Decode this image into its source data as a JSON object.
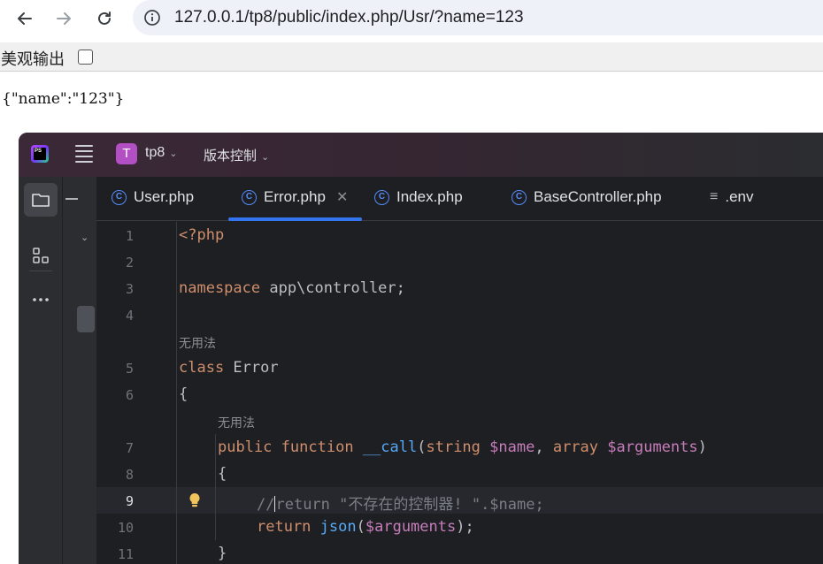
{
  "browser": {
    "url": "127.0.0.1/tp8/public/index.php/Usr/?name=123",
    "icons": [
      "back-icon",
      "forward-icon",
      "reload-icon",
      "info-icon"
    ]
  },
  "page": {
    "pretty_print_label": "美观输出",
    "pretty_print_checked": false,
    "json_output": "{\"name\":\"123\"}"
  },
  "ide": {
    "project_badge": "T",
    "project_name": "tp8",
    "vcs_label": "版本控制",
    "tabs": [
      {
        "label": "User.php",
        "icon": "class-icon",
        "active": false
      },
      {
        "label": "Error.php",
        "icon": "class-icon",
        "active": true
      },
      {
        "label": "Index.php",
        "icon": "class-icon",
        "active": false
      },
      {
        "label": "BaseController.php",
        "icon": "class-icon",
        "active": false
      },
      {
        "label": ".env",
        "icon": "text-file-icon",
        "active": false
      }
    ],
    "accent_color": "#3574f0",
    "hints": {
      "h1": "无用法",
      "h2": "无用法"
    },
    "lines": {
      "n1": "1",
      "n2": "2",
      "n3": "3",
      "n4": "4",
      "n5": "5",
      "n6": "6",
      "n7": "7",
      "n8": "8",
      "n9": "9",
      "n10": "10",
      "n11": "11",
      "l1": "<?php",
      "l3a": "namespace",
      "l3b": " app\\controller;",
      "l5a": "class",
      "l5b": " Error",
      "l6": "{",
      "l7a": "public",
      "l7b": " ",
      "l7c": "function",
      "l7d": " ",
      "l7e": "__call",
      "l7f": "(",
      "l7g": "string",
      "l7h": " ",
      "l7i": "$name",
      "l7j": ", ",
      "l7k": "array",
      "l7l": " ",
      "l7m": "$arguments",
      "l7n": ")",
      "l8": "{",
      "l9a": "//",
      "l9b": "return \"不存在的控制器! \".$name;",
      "l10a": "return",
      "l10b": " ",
      "l10c": "json",
      "l10d": "(",
      "l10e": "$arguments",
      "l10f": ");",
      "l11": "}"
    }
  }
}
